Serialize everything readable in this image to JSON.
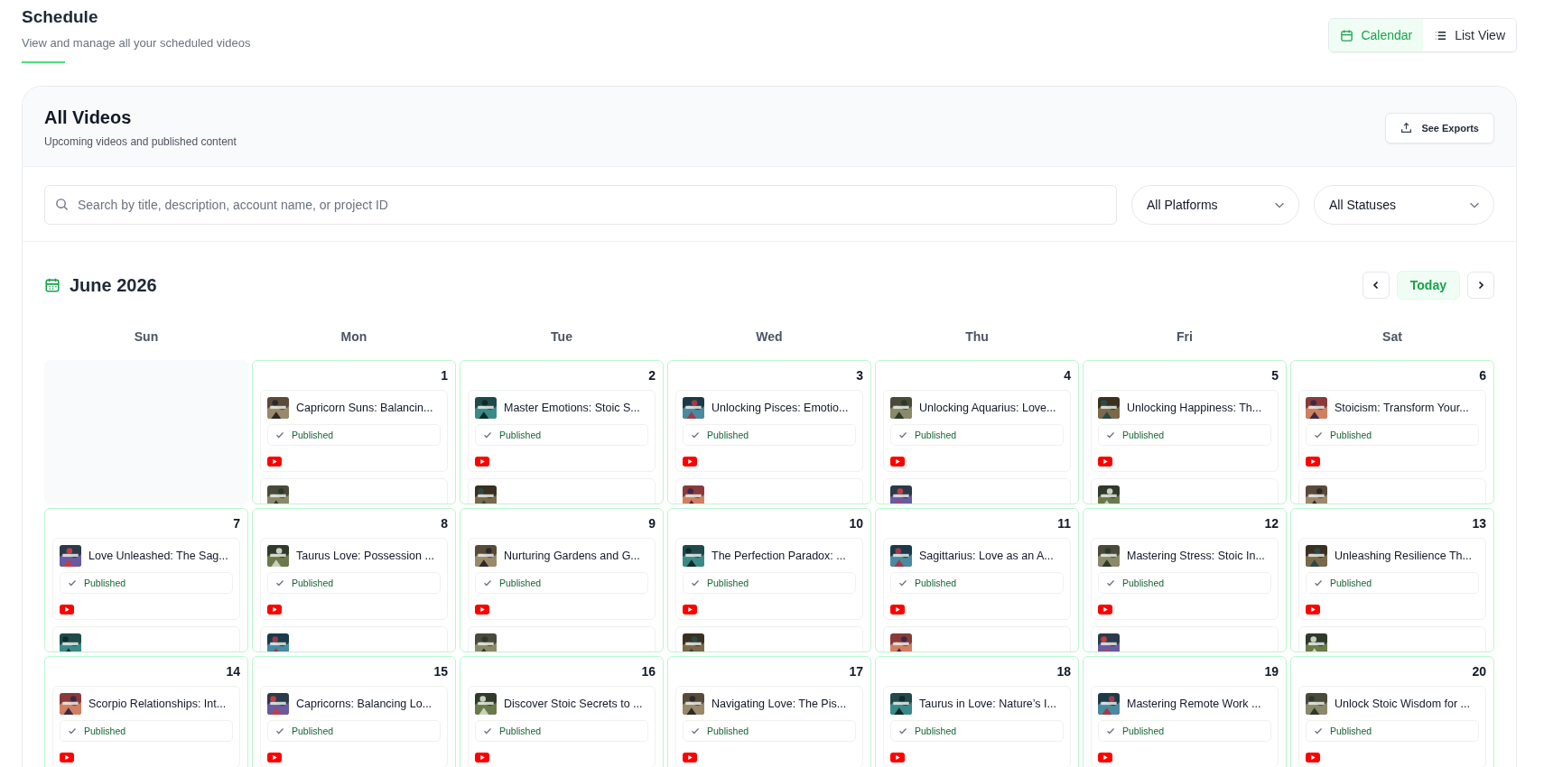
{
  "header": {
    "title": "Schedule",
    "subtitle": "View and manage all your scheduled videos"
  },
  "view_toggle": [
    {
      "label": "Calendar",
      "kind": "calendar",
      "selected": true
    },
    {
      "label": "List View",
      "kind": "list",
      "selected": false
    }
  ],
  "panel": {
    "title": "All Videos",
    "subtitle": "Upcoming videos and published content",
    "export_button": "See Exports"
  },
  "search": {
    "placeholder": "Search by title, description, account name, or project ID"
  },
  "filters": [
    {
      "value": "All Platforms"
    },
    {
      "value": "All Statuses"
    }
  ],
  "calendar": {
    "month": "June 2026",
    "today_button": "Today",
    "weekdays": [
      "Sun",
      "Mon",
      "Tue",
      "Wed",
      "Thu",
      "Fri",
      "Sat"
    ],
    "days": [
      {
        "in_month": false
      },
      {
        "in_month": true,
        "day": "1",
        "more": true,
        "events": [
          {
            "title": "Capricorn Suns: Balancin...",
            "status": "Published",
            "kind": "youtube"
          }
        ]
      },
      {
        "in_month": true,
        "day": "2",
        "more": true,
        "events": [
          {
            "title": "Master Emotions: Stoic S...",
            "status": "Published",
            "kind": "youtube"
          }
        ]
      },
      {
        "in_month": true,
        "day": "3",
        "more": true,
        "events": [
          {
            "title": "Unlocking Pisces: Emotio...",
            "status": "Published",
            "kind": "youtube"
          }
        ]
      },
      {
        "in_month": true,
        "day": "4",
        "more": true,
        "events": [
          {
            "title": "Unlocking Aquarius: Love...",
            "status": "Published",
            "kind": "youtube"
          }
        ]
      },
      {
        "in_month": true,
        "day": "5",
        "more": true,
        "events": [
          {
            "title": "Unlocking Happiness: Th...",
            "status": "Published",
            "kind": "youtube"
          }
        ]
      },
      {
        "in_month": true,
        "day": "6",
        "more": true,
        "events": [
          {
            "title": "Stoicism: Transform Your...",
            "status": "Published",
            "kind": "youtube"
          }
        ]
      },
      {
        "in_month": true,
        "day": "7",
        "more": true,
        "events": [
          {
            "title": "Love Unleashed: The Sag...",
            "status": "Published",
            "kind": "youtube"
          }
        ]
      },
      {
        "in_month": true,
        "day": "8",
        "more": true,
        "events": [
          {
            "title": "Taurus Love: Possession ...",
            "status": "Published",
            "kind": "youtube"
          }
        ]
      },
      {
        "in_month": true,
        "day": "9",
        "more": true,
        "events": [
          {
            "title": "Nurturing Gardens and G...",
            "status": "Published",
            "kind": "youtube"
          }
        ]
      },
      {
        "in_month": true,
        "day": "10",
        "more": true,
        "events": [
          {
            "title": "The Perfection Paradox: ...",
            "status": "Published",
            "kind": "youtube"
          }
        ]
      },
      {
        "in_month": true,
        "day": "11",
        "more": true,
        "events": [
          {
            "title": "Sagittarius: Love as an A...",
            "status": "Published",
            "kind": "youtube"
          }
        ]
      },
      {
        "in_month": true,
        "day": "12",
        "more": true,
        "events": [
          {
            "title": "Mastering Stress: Stoic In...",
            "status": "Published",
            "kind": "youtube"
          }
        ]
      },
      {
        "in_month": true,
        "day": "13",
        "more": true,
        "events": [
          {
            "title": "Unleashing Resilience Th...",
            "status": "Published",
            "kind": "youtube"
          }
        ]
      },
      {
        "in_month": true,
        "day": "14",
        "events": [
          {
            "title": "Scorpio Relationships: Int...",
            "status": "Published",
            "kind": "youtube"
          }
        ]
      },
      {
        "in_month": true,
        "day": "15",
        "events": [
          {
            "title": "Capricorns: Balancing Lo...",
            "status": "Published",
            "kind": "youtube"
          }
        ]
      },
      {
        "in_month": true,
        "day": "16",
        "events": [
          {
            "title": "Discover Stoic Secrets to ...",
            "status": "Published",
            "kind": "youtube"
          }
        ]
      },
      {
        "in_month": true,
        "day": "17",
        "events": [
          {
            "title": "Navigating Love: The Pis...",
            "status": "Published",
            "kind": "youtube"
          }
        ]
      },
      {
        "in_month": true,
        "day": "18",
        "events": [
          {
            "title": "Taurus in Love: Nature’s I...",
            "status": "Published",
            "kind": "youtube"
          }
        ]
      },
      {
        "in_month": true,
        "day": "19",
        "events": [
          {
            "title": "Mastering Remote Work ...",
            "status": "Published",
            "kind": "youtube"
          }
        ]
      },
      {
        "in_month": true,
        "day": "20",
        "events": [
          {
            "title": "Unlock Stoic Wisdom for ...",
            "status": "Published",
            "kind": "youtube"
          }
        ]
      }
    ]
  }
}
